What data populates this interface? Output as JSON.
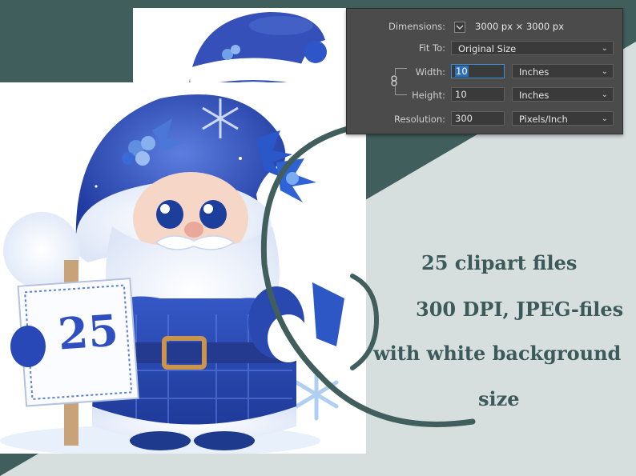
{
  "dialog": {
    "dimensions_label": "Dimensions:",
    "dimensions_value": "3000 px  ×  3000 px",
    "fit_to_label": "Fit To:",
    "fit_to_value": "Original Size",
    "width_label": "Width:",
    "width_value": "10",
    "width_unit": "Inches",
    "height_label": "Height:",
    "height_value": "10",
    "height_unit": "Inches",
    "resolution_label": "Resolution:",
    "resolution_value": "300",
    "resolution_unit": "Pixels/Inch"
  },
  "sign": {
    "number": "25"
  },
  "promo": {
    "line1": "25  clipart  files",
    "line2": "300 DPI, JPEG-files",
    "line3": "with white background",
    "line4": "size"
  },
  "colors": {
    "dark_teal": "#3f5e5c",
    "light_gray": "#d6dfde",
    "hat_blue": "#2f4fb8",
    "text_teal": "#3d5a5a"
  }
}
